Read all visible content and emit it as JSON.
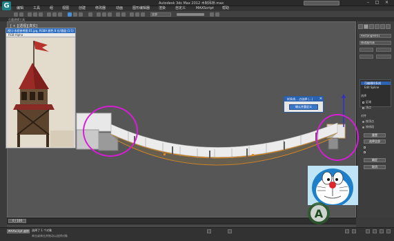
{
  "window": {
    "title": "Autodesk 3ds Max 2012    木制吊桥.max",
    "logo_letter": "G"
  },
  "menu": {
    "items": [
      "编辑",
      "工具",
      "组",
      "视图",
      "创建",
      "修改器",
      "动画",
      "图形编辑器",
      "渲染",
      "自定义",
      "MAXScript",
      "帮助"
    ]
  },
  "toolbar": {
    "selection_filter": "全部"
  },
  "ribbon": {
    "label": "石墨建模工具"
  },
  "viewport": {
    "label": "[ + ][透视][真实]"
  },
  "reference_window": {
    "title": "视口-木桥参考图 01.jpg, RGBA 颜色 8 位/通道 (1:1)",
    "toolbar_label": "RGB Alpha"
  },
  "popup": {
    "title": "样条线... 点选择 (...)",
    "close": "×",
    "button_label": "确认并重定义"
  },
  "command_panel": {
    "object_name": "Rectangle001",
    "modifier_list": "修改器列表",
    "modifiers": [
      "可编辑样条线",
      "Edit Spline"
    ],
    "selection_title": "选择",
    "option_a": "区域",
    "option_b": "顶点",
    "transform_title": "对齐",
    "option_c": "按顶点",
    "option_d": "按线段",
    "button_1": "重置",
    "button_2": "选择全部",
    "button_3": "确定",
    "button_4": "取消"
  },
  "timeline": {
    "frame_counter": "0 / 100"
  },
  "status": {
    "field": "MAXScript 迷你",
    "message": "选择了 1 个对象",
    "prompt": "单击或单击并拖动以选择对象"
  },
  "overlays": {
    "highlight_color": "#d81cd8",
    "watermark_text": "A"
  }
}
